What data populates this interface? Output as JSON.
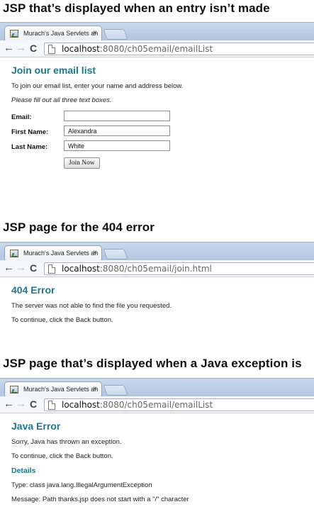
{
  "sections": [
    {
      "heading": "JSP that’s displayed when an entry isn’t made",
      "tab_title": "Murach's Java Servlets an",
      "tab_close": "×",
      "url_host": "localhost",
      "url_path": ":8080/ch05email/emailList",
      "page_title": "Join our email list",
      "intro": "To join our email list, enter your name and address below.",
      "instruction": "Please fill out all three text boxes.",
      "form": {
        "email_label": "Email:",
        "email_value": "",
        "first_name_label": "First Name:",
        "first_name_value": "Alexandra",
        "last_name_label": "Last Name:",
        "last_name_value": "White",
        "submit_label": "Join Now"
      }
    },
    {
      "heading": "JSP page for the 404 error",
      "tab_title": "Murach's Java Servlets an",
      "tab_close": "×",
      "url_host": "localhost",
      "url_path": ":8080/ch05email/join.html",
      "page_title": "404 Error",
      "message": "The server was not able to find the file you requested.",
      "back_hint": "To continue, click the Back button."
    },
    {
      "heading": "JSP page that’s displayed when a Java exception is",
      "tab_title": "Murach's Java Servlets an",
      "tab_close": "×",
      "url_host": "localhost",
      "url_path": ":8080/ch05email/emailList",
      "page_title": "Java Error",
      "message": "Sorry, Java has thrown an exception.",
      "back_hint": "To continue, click the Back button.",
      "details_title": "Details",
      "type_line": "Type: class java.lang.IllegalArgumentException",
      "message_line": "Message: Path thanks.jsp does not start with a \"/\" character"
    }
  ],
  "icons": {
    "back": "back-arrow-icon",
    "forward": "forward-arrow-icon",
    "reload": "reload-icon",
    "page": "page-icon",
    "favicon": "favicon-icon"
  }
}
